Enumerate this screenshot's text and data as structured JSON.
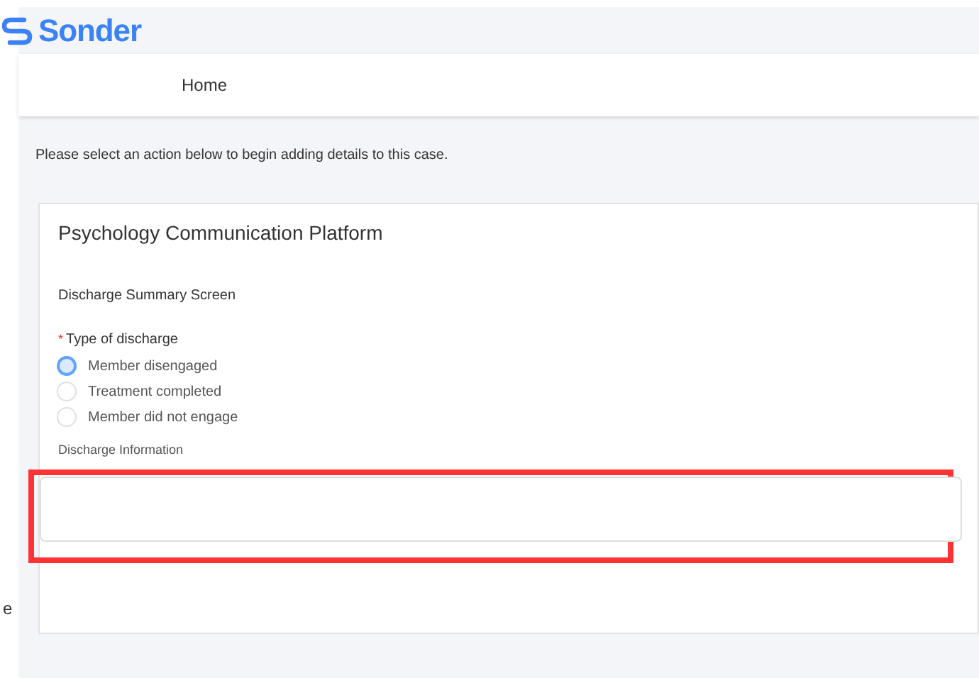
{
  "logo": {
    "text": "Sonder"
  },
  "nav": [
    {
      "label": "Home"
    }
  ],
  "intro": "Please select an action below to begin adding details to this case.",
  "card": {
    "title": "Psychology Communication Platform",
    "screen_title": "Discharge Summary Screen",
    "field": {
      "label": "Type of discharge",
      "required": true,
      "required_mark": "*",
      "options": [
        {
          "label": "Member disengaged",
          "selected": true
        },
        {
          "label": "Treatment completed",
          "selected": false
        },
        {
          "label": "Member did not engage",
          "selected": false
        }
      ]
    },
    "textarea": {
      "label": "Discharge Information",
      "highlighted": true
    }
  },
  "edge_text": "e"
}
